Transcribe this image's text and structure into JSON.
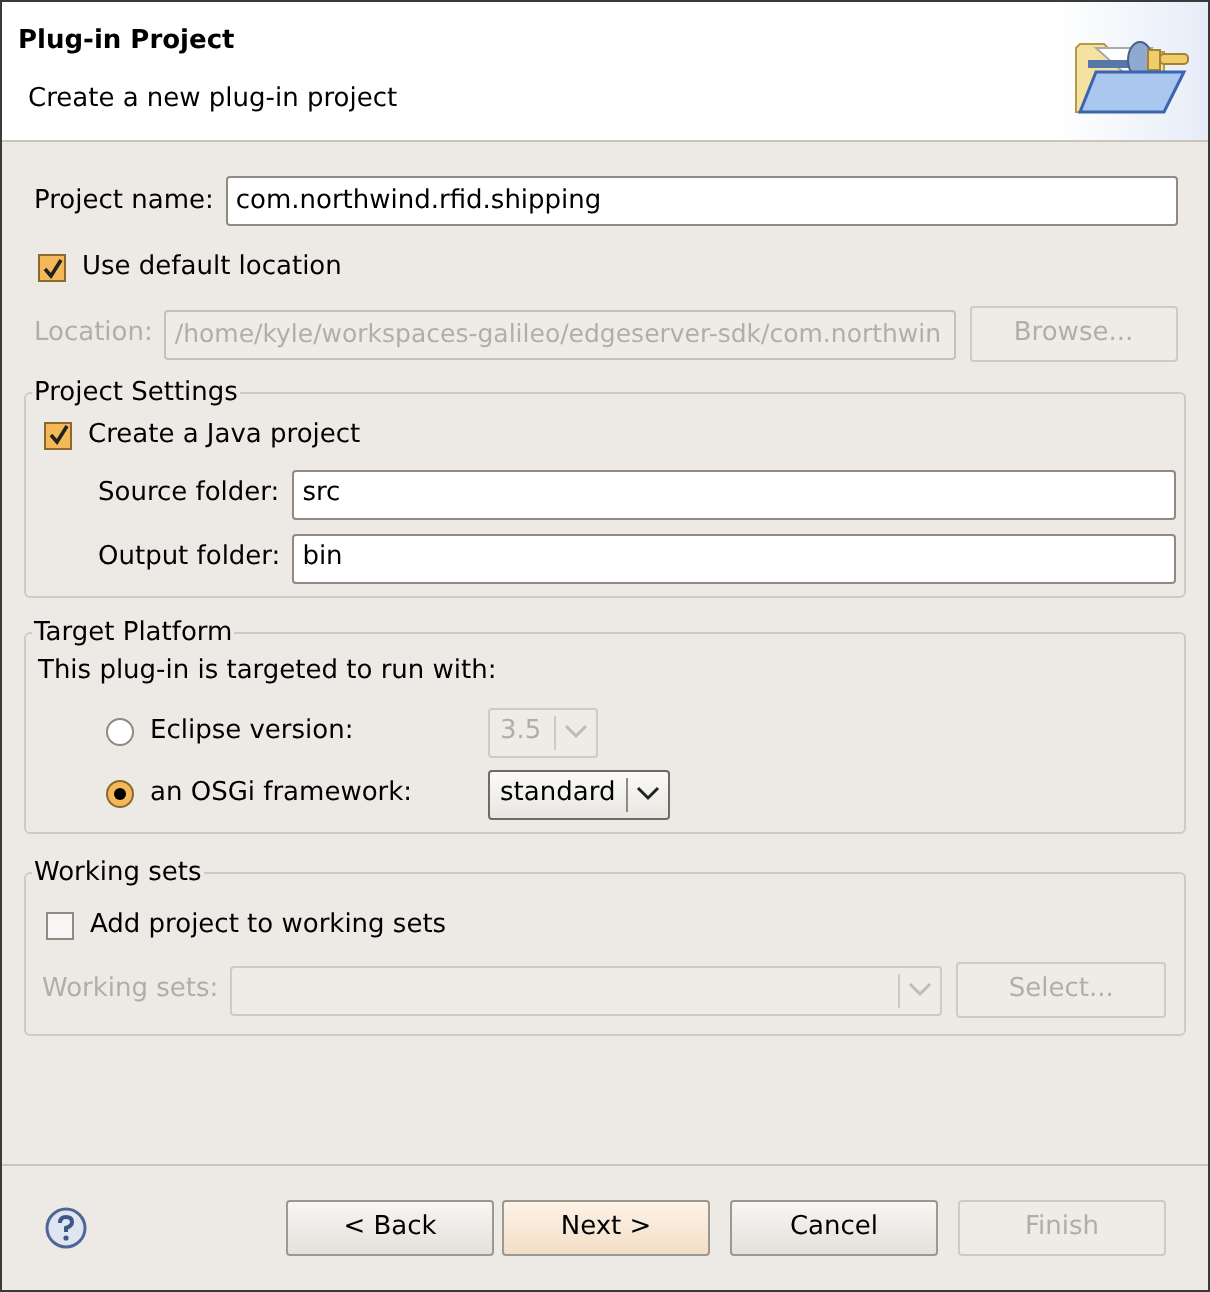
{
  "header": {
    "title": "Plug-in Project",
    "description": "Create a new plug-in project"
  },
  "project_name": {
    "label": "Project name:",
    "value": "com.northwind.rfid.shipping"
  },
  "use_default_location": {
    "label": "Use default location",
    "checked": true
  },
  "location": {
    "label": "Location:",
    "value": "/home/kyle/workspaces-galileo/edgeserver-sdk/com.northwin",
    "button": "Browse..."
  },
  "project_settings": {
    "title": "Project Settings",
    "create_java": {
      "label": "Create a Java project",
      "checked": true
    },
    "fields": [
      {
        "label": "Source folder:",
        "value": "src"
      },
      {
        "label": "Output folder:",
        "value": "bin"
      }
    ]
  },
  "target_platform": {
    "title": "Target Platform",
    "intro": "This plug-in is targeted to run with:",
    "options": [
      {
        "label": "Eclipse version:",
        "selected": false,
        "combo": "3.5"
      },
      {
        "label": "an OSGi framework:",
        "selected": true,
        "combo": "standard"
      }
    ]
  },
  "working_sets": {
    "title": "Working sets",
    "add": {
      "label": "Add project to working sets",
      "checked": false
    },
    "label": "Working sets:",
    "button": "Select..."
  },
  "buttons": [
    {
      "label": "< Back",
      "default": false,
      "disabled": false
    },
    {
      "label": "Next >",
      "default": true,
      "disabled": false
    },
    {
      "label": "Cancel",
      "default": false,
      "disabled": false
    },
    {
      "label": "Finish",
      "default": false,
      "disabled": true
    }
  ]
}
